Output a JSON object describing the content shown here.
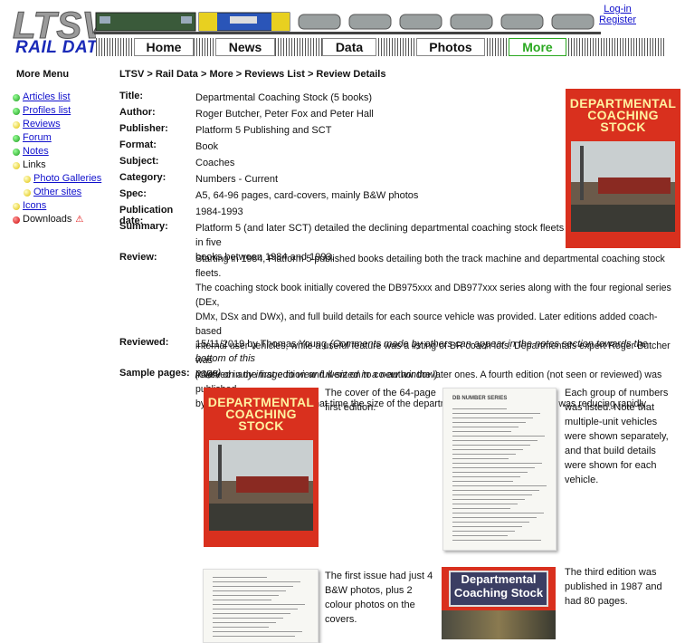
{
  "header": {
    "logo_text": "LTSV",
    "logo_subtitle": "RAIL DATA",
    "login_label": "Log-in",
    "register_label": "Register"
  },
  "nav": {
    "tabs": [
      {
        "label": "Home"
      },
      {
        "label": "News"
      },
      {
        "label": "Data"
      },
      {
        "label": "Photos"
      },
      {
        "label": "More"
      }
    ]
  },
  "sidebar": {
    "title": "More Menu",
    "items": [
      {
        "label": "Articles list",
        "status": "green"
      },
      {
        "label": "Profiles list",
        "status": "green"
      },
      {
        "label": "Reviews",
        "status": "yellow"
      },
      {
        "label": "Forum",
        "status": "green"
      },
      {
        "label": "Notes",
        "status": "green"
      },
      {
        "label": "Links",
        "status": "yellow"
      },
      {
        "label": "Photo Galleries",
        "status": "yellow"
      },
      {
        "label": "Other sites",
        "status": "yellow"
      },
      {
        "label": "Icons",
        "status": "yellow"
      },
      {
        "label": "Downloads",
        "status": "red"
      }
    ]
  },
  "breadcrumb": "LTSV > Rail Data > More > Reviews List > Review Details",
  "details": {
    "title_label": "Title:",
    "title": "Departmental Coaching Stock (5 books)",
    "author_label": "Author:",
    "author": "Roger Butcher, Peter Fox and Peter Hall",
    "publisher_label": "Publisher:",
    "publisher": "Platform 5 Publishing and SCT",
    "format_label": "Format:",
    "format": "Book",
    "subject_label": "Subject:",
    "subject": "Coaches",
    "category_label": "Category:",
    "category": "Numbers - Current",
    "spec_label": "Spec:",
    "spec": "A5, 64-96 pages, card-covers, mainly B&W photos",
    "pubdate_label": "Publication date:",
    "pubdate": "1984-1993",
    "summary_label": "Summary:",
    "summary_lines": [
      "Platform 5 (and later SCT) detailed the declining departmental coaching stock fleets in five",
      "books between 1984 and 1993."
    ],
    "review_label": "Review:",
    "review_lines": [
      "Starting in 1984, Platform 5 published books detailing both the track machine and departmental coaching stock fleets.",
      "The coaching stock book initially covered the DB975xxx and DB977xxx series along with the four regional series (DEx,",
      "DMx, DSx and DWx), and full build details for each source vehicle was provided. Later editions added coach-based",
      "internal user vehicles, while a useful feature was a listing of BR coach lots. Departmentals expert Roger Butcher was",
      "involved in the first edition and went on to co-author the later ones. A fourth edition (not seen or reviewed) was published",
      "by SCT in 1993, though by that time the size of the departmental coaching stock fleet was reducing rapidly."
    ],
    "reviewed_label": "Reviewed:",
    "reviewed_date": "15/11/2019 by Thomas Young",
    "reviewed_note_1": "(Comments made by others can appear in the notes section towards the bottom of this",
    "reviewed_note_2": "page)",
    "samples_label": "Sample pages:",
    "samples_hint": "(Click on any image to view full-sized in a new window)"
  },
  "cover_text": [
    "DEPARTMENTAL",
    "COACHING",
    "STOCK"
  ],
  "samples": [
    {
      "caption": [
        "The cover of the 64-page",
        "first edition."
      ]
    },
    {
      "caption": [
        "Each group of numbers",
        "was listed. Note that",
        "multiple-unit vehicles",
        "were shown separately,",
        "and that build details",
        "were shown for each",
        "vehicle."
      ]
    },
    {
      "caption": [
        "The first issue had just 4",
        "B&W photos, plus 2",
        "colour photos on the",
        "covers."
      ]
    },
    {
      "caption": [
        "The third edition was",
        "published in 1987 and",
        "had 80 pages."
      ]
    }
  ],
  "sample_page_heading": "DB NUMBER SERIES",
  "third_cover_text": [
    "Departmental",
    "Coaching Stock"
  ],
  "colors": {
    "accent_link": "#1010cc",
    "active_tab": "#2aa820",
    "cover_red": "#d9301e"
  }
}
